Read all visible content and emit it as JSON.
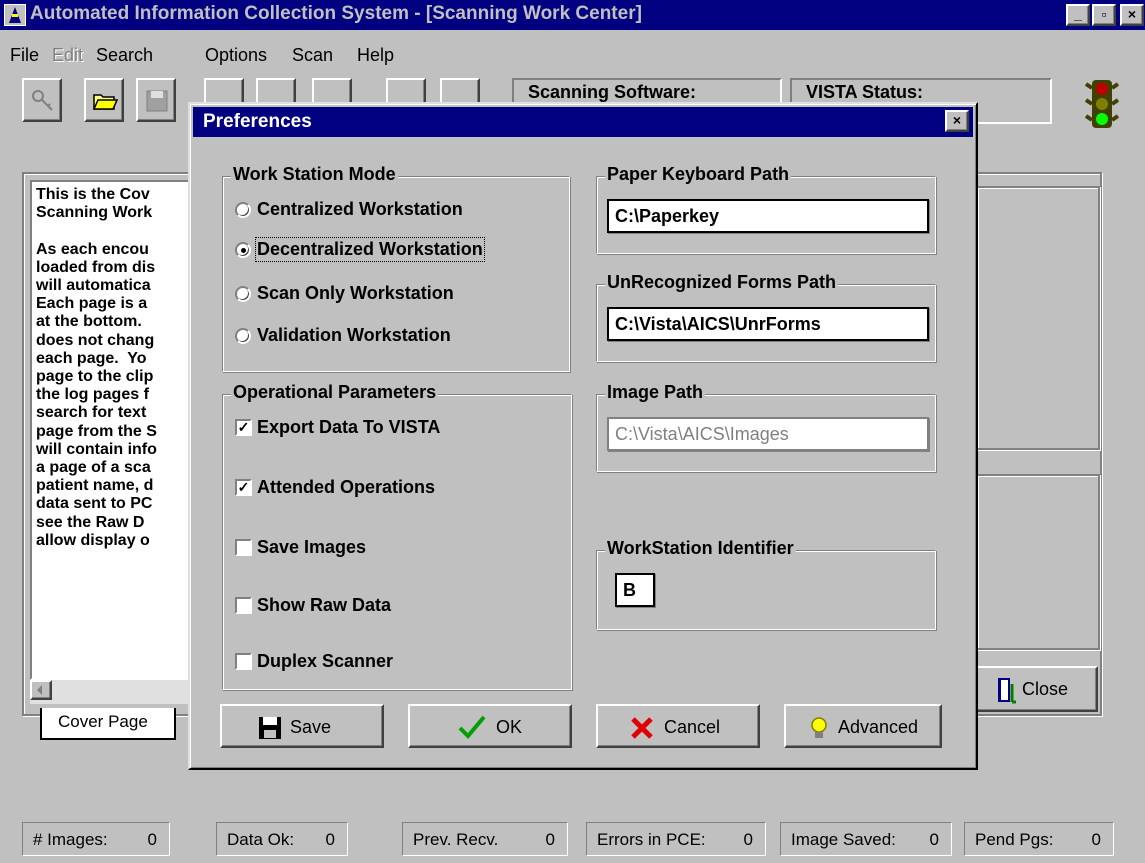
{
  "window": {
    "title": "Automated Information Collection System - [Scanning Work Center]",
    "controls": [
      "_",
      "▫",
      "×"
    ]
  },
  "menu": {
    "items": [
      "File",
      "Edit",
      "Search",
      "Options",
      "Scan",
      "Help"
    ]
  },
  "toolbar": {
    "scanning_software_label": "Scanning Software:",
    "vista_status_label": "VISTA Status:"
  },
  "cover_page": {
    "text_lines": [
      "This is the Cov",
      "Scanning Work",
      "",
      "As each encou",
      "loaded from dis",
      "will automatica",
      "Each page is a",
      "at the bottom.",
      "does not chang",
      "each page.  Yo",
      "page to the clip",
      "the log pages f",
      "search for text",
      "page from the S",
      "will contain info",
      "a page of a sca",
      "patient name, d",
      "data sent to PC",
      "see the Raw D",
      "allow display o"
    ],
    "tab_label": "Cover Page"
  },
  "close_button": {
    "label": "Close"
  },
  "status_bar": [
    {
      "label": "# Images:",
      "value": "0"
    },
    {
      "label": "Data Ok:",
      "value": "0"
    },
    {
      "label": "Prev. Recv.",
      "value": "0"
    },
    {
      "label": "Errors in PCE:",
      "value": "0"
    },
    {
      "label": "Image Saved:",
      "value": "0"
    },
    {
      "label": "Pend Pgs:",
      "value": "0"
    }
  ],
  "dialog": {
    "title": "Preferences",
    "close": "×",
    "work_station_mode": {
      "label": "Work Station Mode",
      "options": [
        {
          "label": "Centralized Workstation",
          "selected": false
        },
        {
          "label": "Decentralized Workstation",
          "selected": true
        },
        {
          "label": "Scan Only Workstation",
          "selected": false
        },
        {
          "label": "Validation Workstation",
          "selected": false
        }
      ]
    },
    "operational_parameters": {
      "label": "Operational Parameters",
      "options": [
        {
          "label": "Export Data To VISTA",
          "checked": true
        },
        {
          "label": "Attended Operations",
          "checked": true
        },
        {
          "label": "Save Images",
          "checked": false
        },
        {
          "label": "Show Raw Data",
          "checked": false
        },
        {
          "label": "Duplex Scanner",
          "checked": false
        }
      ]
    },
    "paper_keyboard_path": {
      "label": "Paper Keyboard Path",
      "value": "C:\\Paperkey"
    },
    "unrecognized_forms_path": {
      "label": "UnRecognized Forms Path",
      "value": "C:\\Vista\\AICS\\UnrForms"
    },
    "image_path": {
      "label": "Image Path",
      "value": "C:\\Vista\\AICS\\Images"
    },
    "workstation_identifier": {
      "label": "WorkStation Identifier",
      "value": "B"
    },
    "buttons": {
      "save": "Save",
      "ok": "OK",
      "cancel": "Cancel",
      "advanced": "Advanced"
    }
  }
}
